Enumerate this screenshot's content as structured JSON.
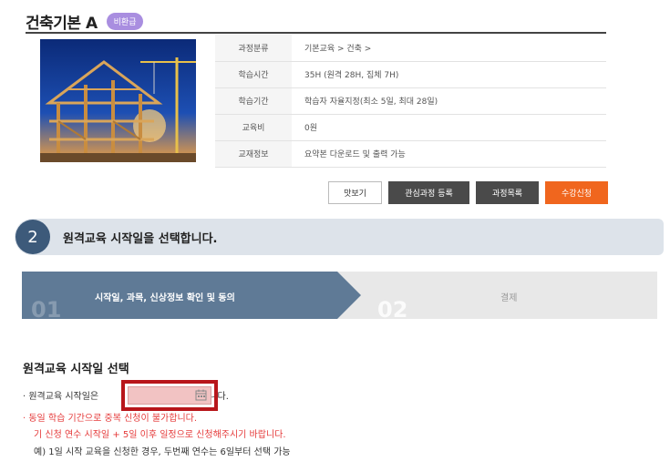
{
  "course": {
    "title": "건축기본 A",
    "badge": "비환급",
    "rows": [
      {
        "label": "과정분류",
        "value": "기본교육 > 건축 >"
      },
      {
        "label": "학습시간",
        "value": "35H (원격 28H, 집체 7H)"
      },
      {
        "label": "학습기간",
        "value": "학습자 자율지정(최소 5일, 최대 28일)"
      },
      {
        "label": "교육비",
        "value": "0원"
      },
      {
        "label": "교재정보",
        "value": "요약본 다운로드 및 출력 가능"
      }
    ]
  },
  "buttons": {
    "preview": "맛보기",
    "wishlist": "관심과정 등록",
    "list": "과정목록",
    "apply": "수강신청"
  },
  "step": {
    "number": "2",
    "text": "원격교육 시작일을 선택합니다."
  },
  "progress": {
    "step1_num": "01",
    "step1_label": "시작일, 과목, 신상정보 확인 및 동의",
    "step2_num": "02",
    "step2_label": "결제"
  },
  "start_date": {
    "title": "원격교육 시작일 선택",
    "line1_prefix": "· 원격교육 시작일은",
    "line1_suffix": "입니다.",
    "line2": "· 동일 학습 기간으로 중복 신청이 불가합니다.",
    "line3": "기 신청 연수 시작일 + 5일 이후 일정으로 신청해주시기 바랍니다.",
    "line4": "예) 1일 시작 교육을 신청한 경우, 두번째 연수는 6일부터 선택 가능",
    "input_value": ""
  },
  "colors": {
    "accent": "#f0661e",
    "step_circle": "#3d5a7a",
    "active_progress": "#5f7a96",
    "warning_text": "#e53a3a",
    "highlight_border": "#b8161b"
  }
}
